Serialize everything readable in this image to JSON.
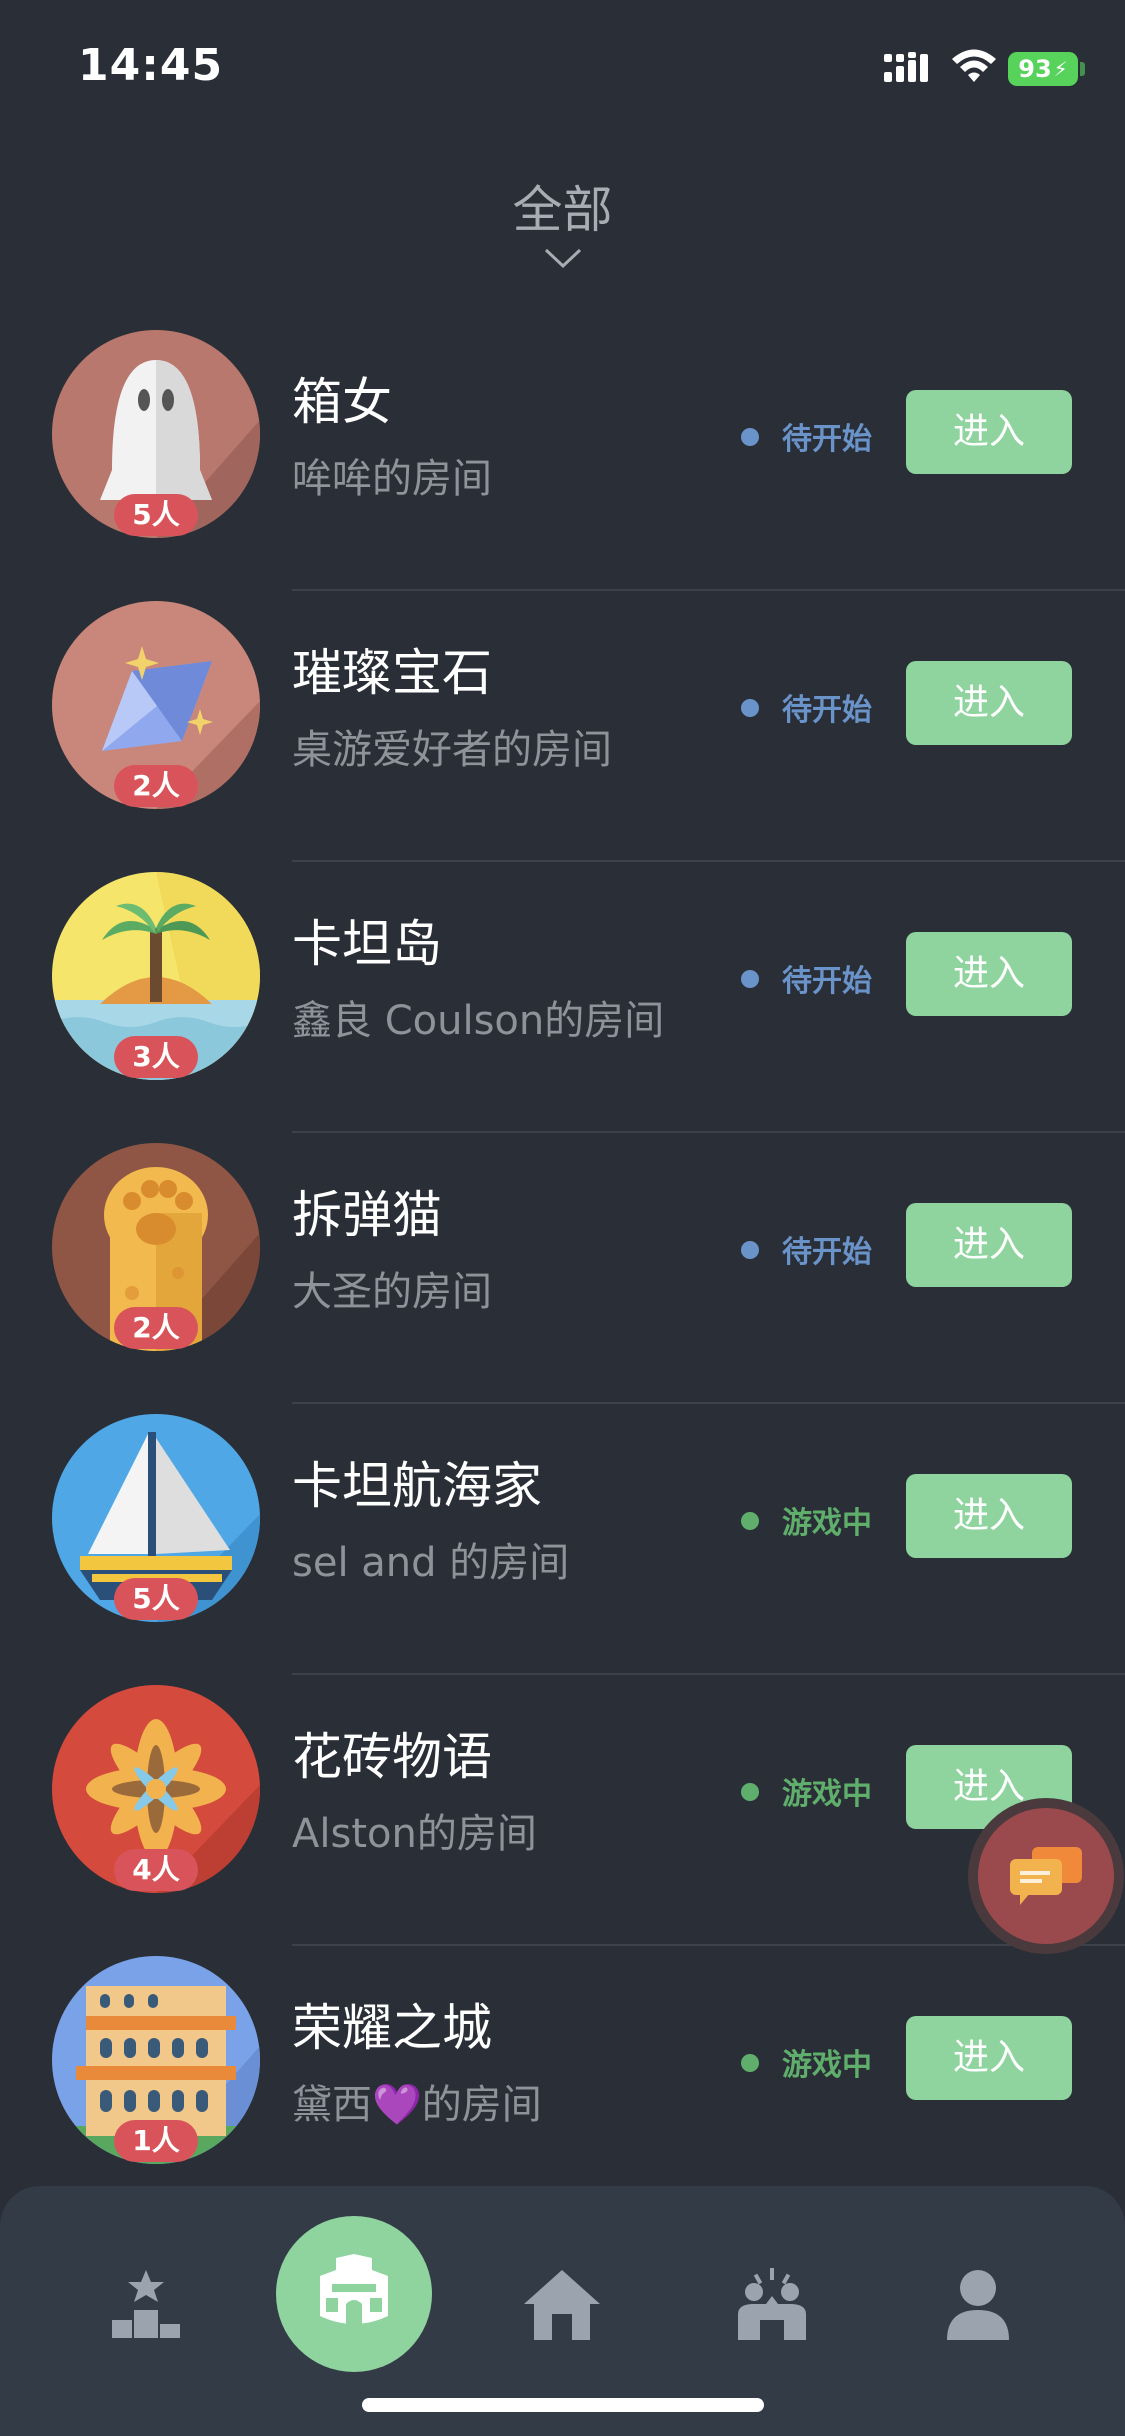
{
  "status_bar": {
    "time": "14:45",
    "battery": "93"
  },
  "filter": {
    "label": "全部"
  },
  "rooms": [
    {
      "name": "箱女",
      "host": "哞哞的房间",
      "players": "5人",
      "status": "待开始",
      "status_kind": "waiting",
      "enter_label": "进入",
      "icon": "ghost-icon"
    },
    {
      "name": "璀璨宝石",
      "host": "桌游爱好者的房间",
      "players": "2人",
      "status": "待开始",
      "status_kind": "waiting",
      "enter_label": "进入",
      "icon": "gem-icon"
    },
    {
      "name": "卡坦岛",
      "host": "鑫良 Coulson的房间",
      "players": "3人",
      "status": "待开始",
      "status_kind": "waiting",
      "enter_label": "进入",
      "icon": "island-icon"
    },
    {
      "name": "拆弹猫",
      "host": "大圣的房间",
      "players": "2人",
      "status": "待开始",
      "status_kind": "waiting",
      "enter_label": "进入",
      "icon": "cat-paw-icon"
    },
    {
      "name": "卡坦航海家",
      "host": "sel and 的房间",
      "players": "5人",
      "status": "游戏中",
      "status_kind": "playing",
      "enter_label": "进入",
      "icon": "sailboat-icon"
    },
    {
      "name": "花砖物语",
      "host": "Alston的房间",
      "players": "4人",
      "status": "游戏中",
      "status_kind": "playing",
      "enter_label": "进入",
      "icon": "tile-flower-icon"
    },
    {
      "name": "荣耀之城",
      "host": "黛西💜的房间",
      "players": "1人",
      "status": "游戏中",
      "status_kind": "playing",
      "enter_label": "进入",
      "icon": "colosseum-icon"
    }
  ],
  "colors": {
    "waiting": "#6a93c9",
    "playing": "#5fae6b",
    "enter_button": "#8fd49f",
    "player_badge": "#d9545a",
    "background": "#2a2f37"
  },
  "tabbar": {
    "items": [
      {
        "icon": "leaderboard-icon"
      },
      {
        "icon": "arena-icon",
        "active": true
      },
      {
        "icon": "home-icon"
      },
      {
        "icon": "friends-icon"
      },
      {
        "icon": "profile-icon"
      }
    ]
  }
}
